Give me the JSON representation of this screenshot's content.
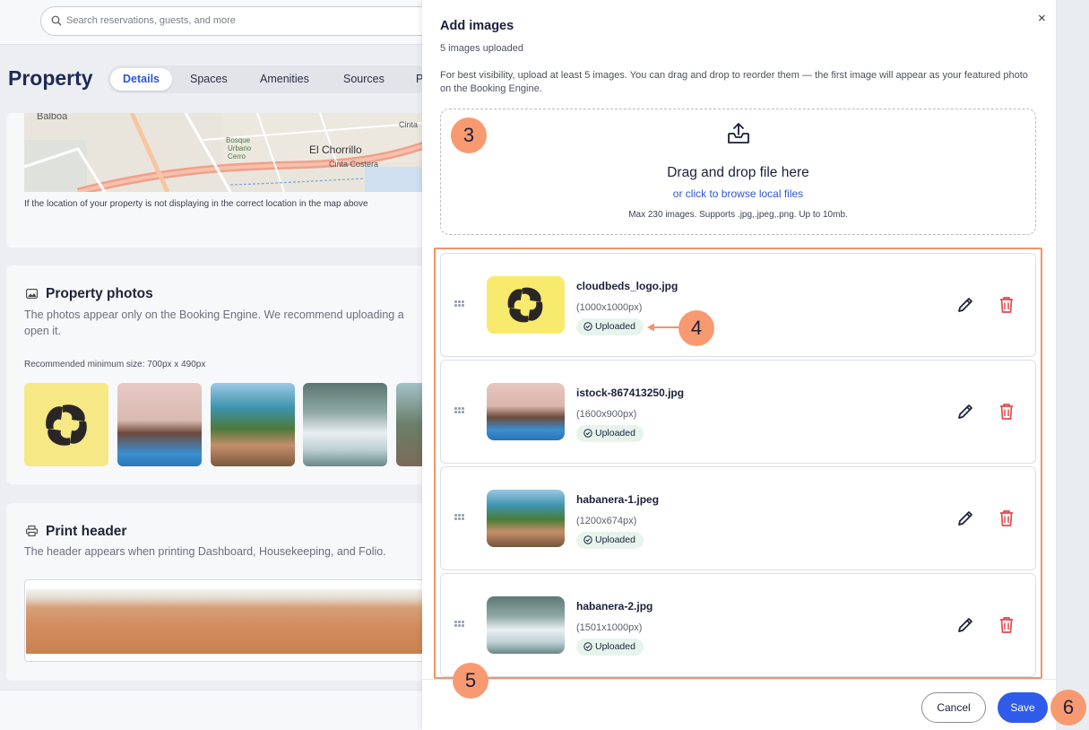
{
  "colors": {
    "accent": "#2e5be9",
    "highlight": "#f2936b",
    "callout": "#f89a71",
    "delete": "#e5484d",
    "success_bg": "#e7f4ec"
  },
  "search": {
    "placeholder": "Search reservations, guests, and more"
  },
  "page": {
    "title": "Property",
    "tabs": [
      {
        "label": "Details",
        "active": true
      },
      {
        "label": "Spaces"
      },
      {
        "label": "Amenities"
      },
      {
        "label": "Sources"
      },
      {
        "label": "P"
      }
    ],
    "map_labels": {
      "balboa": "Balboa",
      "bosque1": "Bosque",
      "bosque2": "Urbano",
      "bosque3": "Cerro",
      "chorrillo": "El Chorrillo",
      "cinta": "Cinta Costera",
      "cinta2": "Cinta"
    },
    "map_caption": "If the location of your property is not displaying in the correct location in the map above",
    "photos": {
      "title": "Property photos",
      "desc_line1": "The photos appear only on the Booking Engine. We recommend uploading a",
      "desc_line2": "open it.",
      "min_size": "Recommended minimum size: 700px x 490px"
    },
    "print_header": {
      "title": "Print header",
      "desc": "The header appears when printing Dashboard, Housekeeping, and Folio."
    }
  },
  "dialog": {
    "title": "Add images",
    "close_icon": "×",
    "subtitle": "5 images uploaded",
    "info": "For best visibility, upload at least 5 images. You can drag and drop to reorder them — the first image will appear as your featured photo on the Booking Engine.",
    "dropzone": {
      "title": "Drag and drop file here",
      "link": "or click to browse local files",
      "hint": "Max 230 images. Supports .jpg,.jpeg,.png. Up to 10mb."
    },
    "images": [
      {
        "name": "cloudbeds_logo.jpg",
        "dims": "(1000x1000px)",
        "status": "Uploaded"
      },
      {
        "name": "istock-867413250.jpg",
        "dims": "(1600x900px)",
        "status": "Uploaded"
      },
      {
        "name": "habanera-1.jpeg",
        "dims": "(1200x674px)",
        "status": "Uploaded"
      },
      {
        "name": "habanera-2.jpg",
        "dims": "(1501x1000px)",
        "status": "Uploaded"
      }
    ],
    "cancel_label": "Cancel",
    "save_label": "Save"
  },
  "callouts": {
    "c3": "3",
    "c4": "4",
    "c5": "5",
    "c6": "6"
  }
}
